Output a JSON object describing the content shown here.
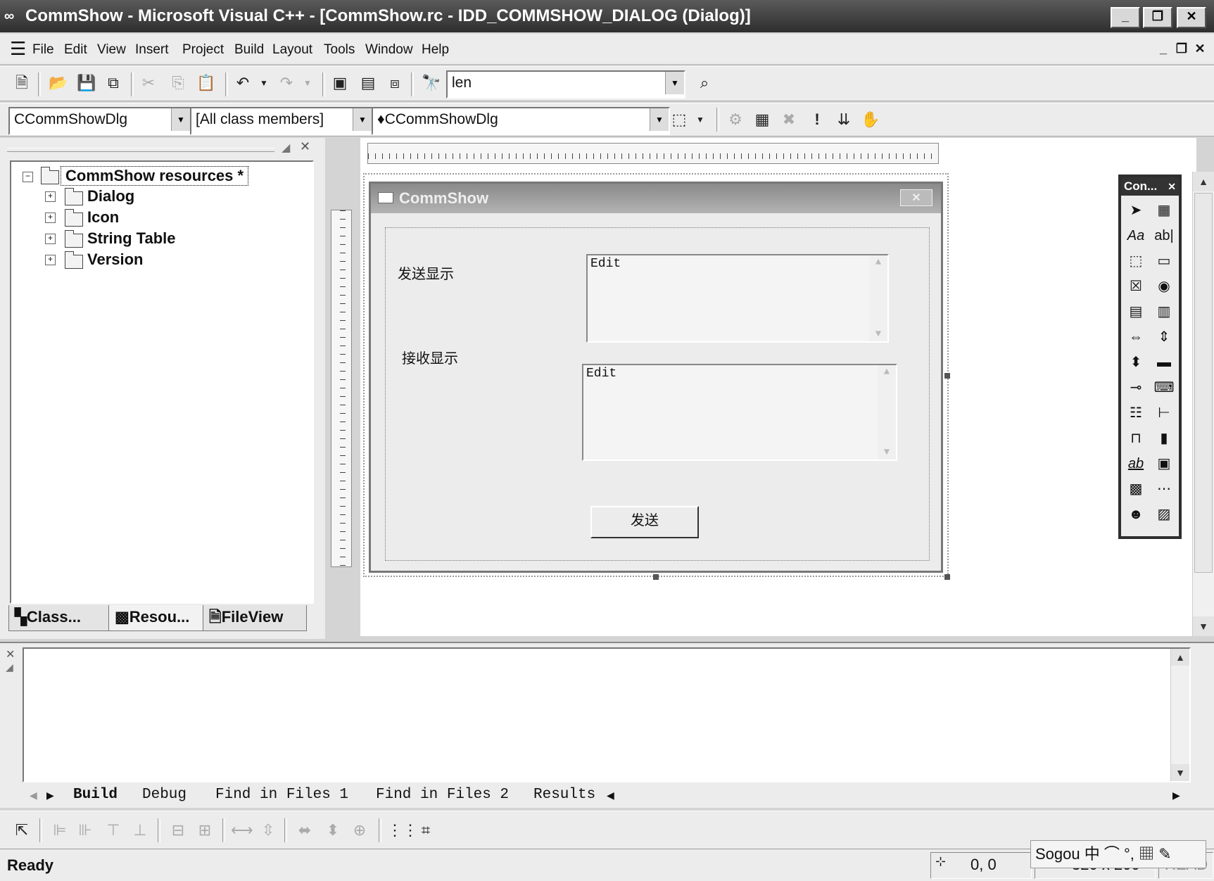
{
  "window": {
    "title": "CommShow - Microsoft Visual C++ - [CommShow.rc - IDD_COMMSHOW_DIALOG (Dialog)]",
    "controls": [
      "_",
      "❐",
      "✕"
    ]
  },
  "menu": {
    "items": [
      "File",
      "Edit",
      "View",
      "Insert",
      "Project",
      "Build",
      "Layout",
      "Tools",
      "Window",
      "Help"
    ],
    "underline": [
      "F",
      "E",
      "V",
      "I",
      "P",
      "B",
      "L",
      "T",
      "W",
      "H"
    ],
    "mdi_controls": [
      "_",
      "❐",
      "✕"
    ]
  },
  "toolbar": {
    "find_value": "len",
    "class_combo": "CCommShowDlg",
    "members_combo": "[All class members]",
    "function_combo": "♦CCommShowDlg"
  },
  "workspace": {
    "root": "CommShow resources *",
    "nodes": [
      "Dialog",
      "Icon",
      "String Table",
      "Version"
    ],
    "tabs": [
      "Class...",
      "Resou...",
      "FileView"
    ]
  },
  "dialog": {
    "title": "CommShow",
    "close": "✕",
    "label_send": "发送显示",
    "label_recv": "接收显示",
    "edit1": "Edit",
    "edit2": "Edit",
    "button": "发送"
  },
  "controls_palette": {
    "title": "Con...",
    "close": "✕"
  },
  "output": {
    "tabs": [
      "Build",
      "Debug",
      "Find in Files 1",
      "Find in Files 2",
      "Results"
    ]
  },
  "status": {
    "text": "Ready",
    "coords": "0, 0",
    "size": "320 x 200",
    "read": "READ"
  },
  "ime": {
    "text": "Sogou 中 ⌒ °, ▦ ✎"
  }
}
